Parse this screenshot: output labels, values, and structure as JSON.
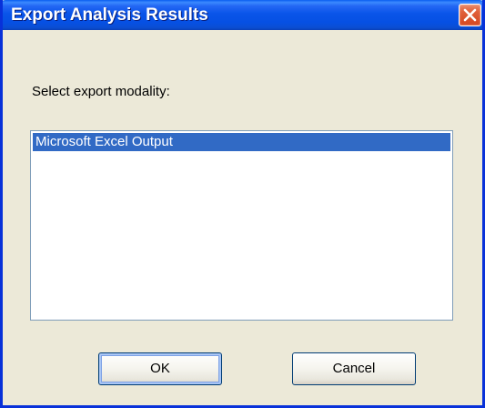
{
  "window": {
    "title": "Export Analysis Results",
    "close_icon": "close-icon"
  },
  "prompt": {
    "label": "Select export modality:"
  },
  "modality_list": {
    "items": [
      "Microsoft Excel Output"
    ],
    "selected_index": 0
  },
  "buttons": {
    "ok_label": "OK",
    "cancel_label": "Cancel"
  },
  "colors": {
    "titlebar": "#0a55e9",
    "selection": "#316ac5",
    "dialog_background": "#ece9d8",
    "close_button": "#e0603a"
  }
}
